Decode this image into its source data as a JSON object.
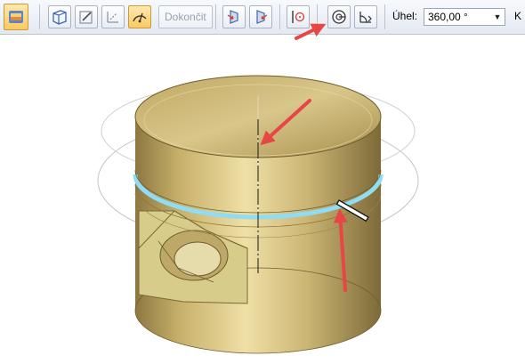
{
  "toolbar": {
    "items": [
      {
        "name": "part-icon",
        "type": "icon"
      },
      {
        "name": "select-plane-icon",
        "type": "button"
      },
      {
        "name": "sketch-icon",
        "type": "button"
      },
      {
        "name": "axis-icon",
        "type": "button"
      },
      {
        "name": "revolve-angle-icon",
        "type": "button"
      },
      {
        "name": "finish",
        "label": "Dokončit"
      },
      {
        "name": "extent-side1-icon",
        "type": "button"
      },
      {
        "name": "extent-side2-icon",
        "type": "button"
      },
      {
        "name": "axis-point-icon",
        "type": "button"
      },
      {
        "name": "revolve-360-icon",
        "type": "button"
      },
      {
        "name": "angle-symmetric-icon",
        "type": "button"
      }
    ],
    "finish_label": "Dokončit",
    "angle_label": "Úhel:",
    "angle_value": "360,00 °",
    "extra_label": "K"
  },
  "colors": {
    "accent_orange": "#fbc961",
    "arrow_red": "#e84545",
    "highlight_cyan": "#8fdcf3",
    "body_gold": "#d6c58a"
  }
}
